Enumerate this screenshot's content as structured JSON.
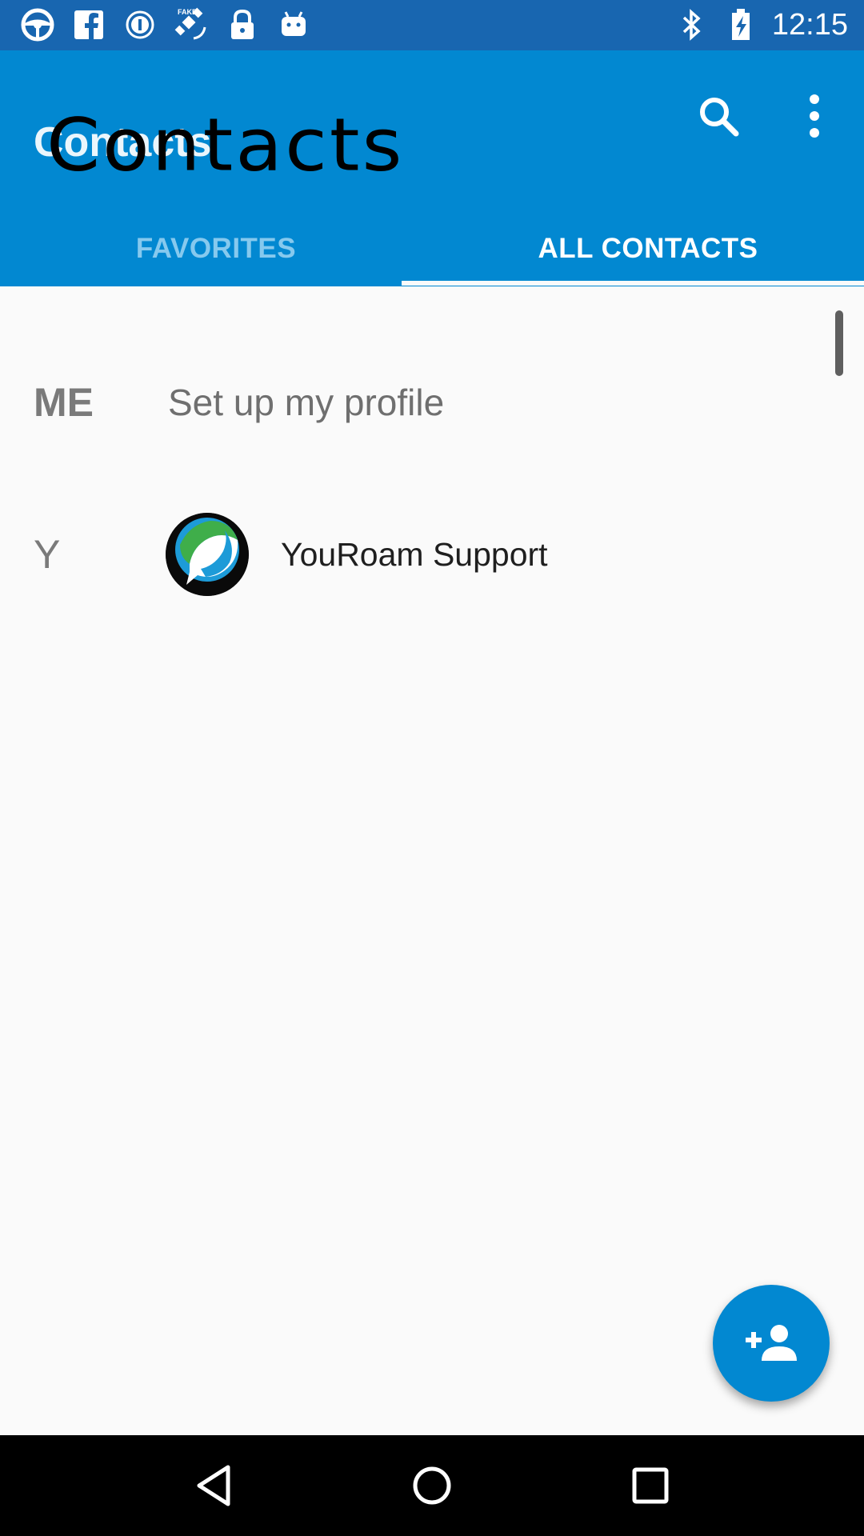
{
  "status_bar": {
    "time": "12:15",
    "left_icons": [
      "steering-wheel-icon",
      "facebook-icon",
      "info-circle-icon",
      "fake-gps-satellite-icon",
      "lock-icon",
      "android-icon"
    ],
    "right_icons": [
      "bluetooth-icon",
      "battery-icon"
    ]
  },
  "app_bar": {
    "title": "Contacts",
    "title_overlay": "Contacts",
    "background_color": "#0288d1",
    "actions": [
      "search-icon",
      "more-vert-icon"
    ]
  },
  "tabs": [
    {
      "label": "FAVORITES",
      "active": false
    },
    {
      "label": "ALL CONTACTS",
      "active": true
    }
  ],
  "list": {
    "me": {
      "section": "ME",
      "text": "Set up my profile"
    },
    "contacts": [
      {
        "section": "Y",
        "name": "YouRoam Support",
        "avatar": "youroam-logo-icon"
      }
    ]
  },
  "fab": {
    "icon": "add-person-icon"
  },
  "nav_bar": {
    "buttons": [
      "back-icon",
      "home-icon",
      "recents-icon"
    ]
  }
}
